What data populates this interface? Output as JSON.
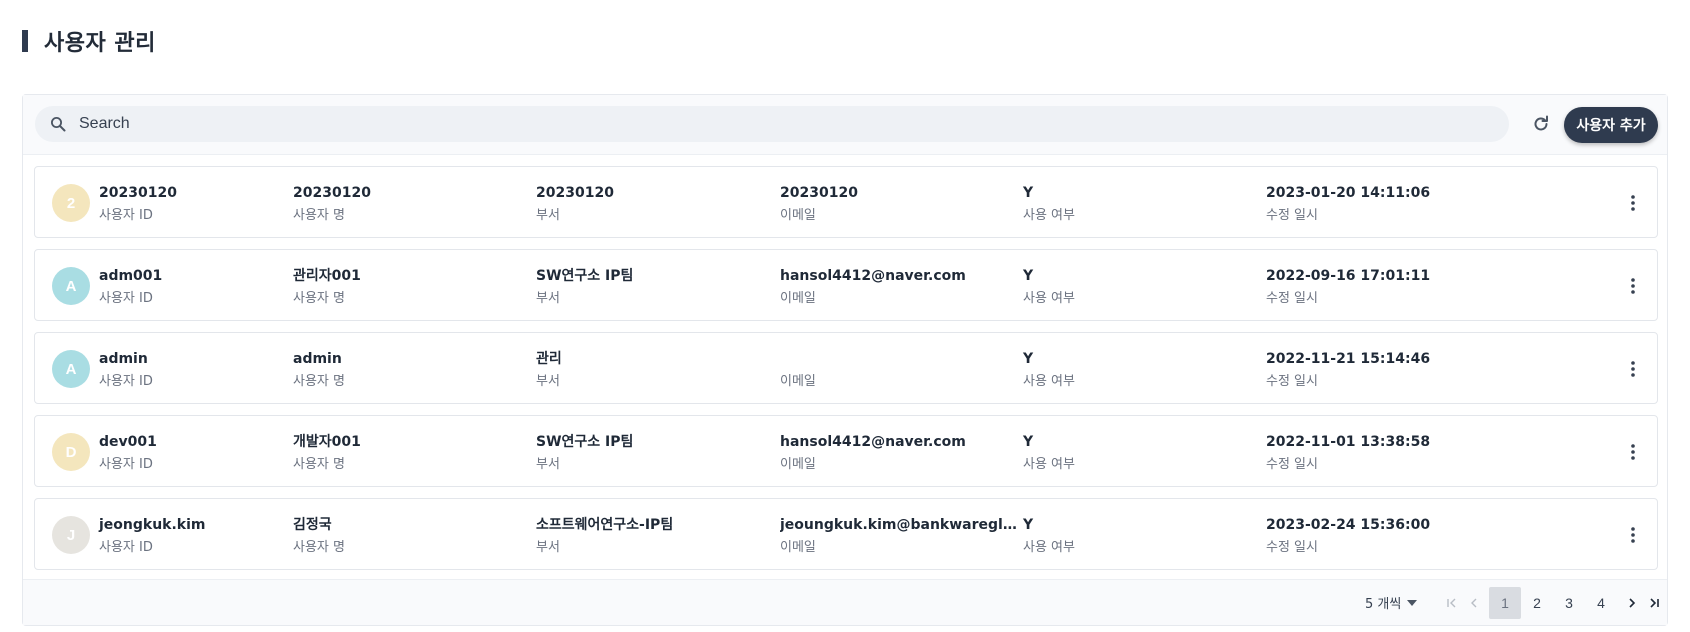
{
  "header": {
    "title": "사용자 관리"
  },
  "search": {
    "placeholder": "Search",
    "value": ""
  },
  "toolbar": {
    "add_label": "사용자 추가"
  },
  "labels": {
    "user_id": "사용자 ID",
    "user_name": "사용자 명",
    "dept": "부서",
    "email": "이메일",
    "use_yn": "사용 여부",
    "modified_at": "수정 일시"
  },
  "users": [
    {
      "initial": "2",
      "avatar_color": "#f4e6bd",
      "user_id": "20230120",
      "user_name": "20230120",
      "dept": "20230120",
      "email": "20230120",
      "use_yn": "Y",
      "modified_at": "2023-01-20 14:11:06"
    },
    {
      "initial": "A",
      "avatar_color": "#a9dde3",
      "user_id": "adm001",
      "user_name": "관리자001",
      "dept": "SW연구소 IP팀",
      "email": "hansol4412@naver.com",
      "use_yn": "Y",
      "modified_at": "2022-09-16 17:01:11"
    },
    {
      "initial": "A",
      "avatar_color": "#a9dde3",
      "user_id": "admin",
      "user_name": "admin",
      "dept": "관리",
      "email": "",
      "use_yn": "Y",
      "modified_at": "2022-11-21 15:14:46"
    },
    {
      "initial": "D",
      "avatar_color": "#f4e6bd",
      "user_id": "dev001",
      "user_name": "개발자001",
      "dept": "SW연구소 IP팀",
      "email": "hansol4412@naver.com",
      "use_yn": "Y",
      "modified_at": "2022-11-01 13:38:58"
    },
    {
      "initial": "J",
      "avatar_color": "#e6e4df",
      "user_id": "jeongkuk.kim",
      "user_name": "김정국",
      "dept": "소프트웨어연구소-IP팀",
      "email": "jeoungkuk.kim@bankwareglobal.com",
      "use_yn": "Y",
      "modified_at": "2023-02-24 15:36:00"
    }
  ],
  "pagination": {
    "page_size_label": "5 개씩",
    "pages": [
      "1",
      "2",
      "3",
      "4"
    ],
    "current_page": 1
  },
  "icons": {
    "search": "search-icon",
    "refresh": "refresh-icon",
    "more": "more-vertical-icon",
    "first": "first-page-icon",
    "prev": "prev-page-icon",
    "next": "next-page-icon",
    "last": "last-page-icon",
    "caret": "caret-down-icon"
  },
  "colors": {
    "primary": "#2f3b4f",
    "page_active_bg": "#d9dce1"
  }
}
